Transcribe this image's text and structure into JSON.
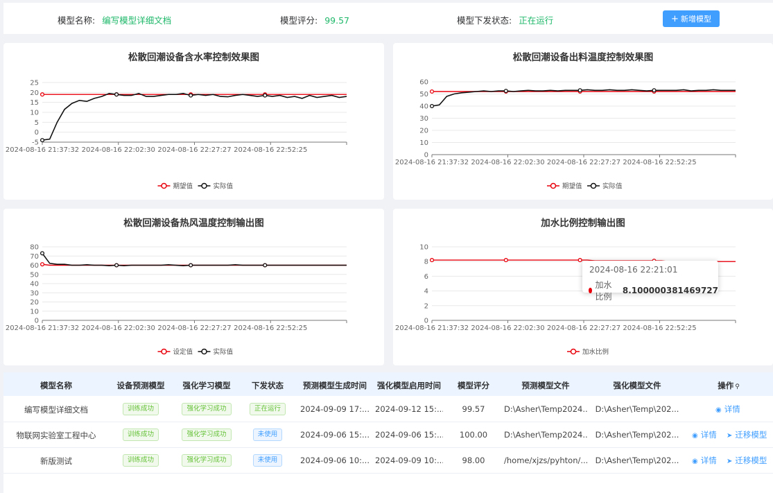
{
  "header": {
    "model_name_label": "模型名称:",
    "model_name_value": "编写模型详细文档",
    "score_label": "模型评分:",
    "score_value": "99.57",
    "status_label": "模型下发状态:",
    "status_value": "正在运行",
    "add_button": "新增模型"
  },
  "colors": {
    "accent": "#409eff",
    "success": "#1fb86a",
    "expected": "#e8000b",
    "actual": "#111111"
  },
  "chart_data": [
    {
      "type": "line",
      "title": "松散回潮设备含水率控制效果图",
      "x_ticks": [
        "2024-08-16 21:37:32",
        "2024-08-16 22:02:30",
        "2024-08-16 22:27:27",
        "2024-08-16 22:52:25"
      ],
      "ylim": [
        -5,
        25
      ],
      "y_ticks": [
        -5,
        0,
        5,
        10,
        15,
        20,
        25
      ],
      "legend": [
        "期望值",
        "实际值"
      ],
      "series": [
        {
          "name": "期望值",
          "values": [
            19,
            19,
            19,
            19,
            19,
            19,
            19,
            19,
            19,
            19,
            19,
            19,
            19,
            19,
            19,
            19,
            19,
            19,
            19,
            19,
            19,
            19,
            19,
            19,
            19,
            19,
            19,
            19,
            19,
            19,
            19,
            19,
            19,
            19,
            19,
            19,
            19,
            19,
            19,
            19,
            19,
            19
          ]
        },
        {
          "name": "实际值",
          "values": [
            -4,
            -3.5,
            5,
            11.5,
            14.5,
            16,
            15.5,
            17,
            18,
            19.5,
            19,
            18.5,
            18.5,
            19.5,
            18,
            18,
            18.5,
            19,
            19,
            19.5,
            18.5,
            19,
            18.5,
            19,
            18,
            17.8,
            18.5,
            19,
            18.5,
            18,
            18.5,
            18,
            18.5,
            17.5,
            18,
            17,
            18.5,
            17.5,
            18,
            18.5,
            17.5,
            18
          ]
        }
      ]
    },
    {
      "type": "line",
      "title": "松散回潮设备出料温度控制效果图",
      "x_ticks": [
        "2024-08-16 21:37:32",
        "2024-08-16 22:02:30",
        "2024-08-16 22:27:27",
        "2024-08-16 22:52:25"
      ],
      "ylim": [
        0,
        60
      ],
      "y_ticks": [
        0,
        10,
        20,
        30,
        40,
        50,
        60
      ],
      "legend": [
        "期望值",
        "实际值"
      ],
      "series": [
        {
          "name": "期望值",
          "values": [
            52,
            52,
            52,
            52,
            52,
            52,
            52,
            52,
            52,
            52,
            52,
            52,
            52,
            52,
            52,
            52,
            52,
            52,
            52,
            52,
            52,
            52,
            52,
            52,
            52,
            52,
            52,
            52,
            52,
            52,
            52,
            52,
            52,
            52,
            52,
            52,
            52,
            52,
            52,
            52,
            52,
            52
          ]
        },
        {
          "name": "实际值",
          "values": [
            40,
            41,
            48,
            50,
            51,
            51.5,
            52,
            52.5,
            52,
            52.5,
            52.5,
            52,
            52.5,
            53,
            52.5,
            52.5,
            53,
            52.5,
            53,
            53,
            53,
            53.5,
            53,
            53,
            53.5,
            53,
            53,
            53.5,
            53,
            52.5,
            53,
            53,
            53,
            53,
            53.5,
            52.5,
            53,
            53,
            53.5,
            53,
            53,
            53
          ]
        }
      ]
    },
    {
      "type": "line",
      "title": "松散回潮设备热风温度控制输出图",
      "x_ticks": [
        "2024-08-16 21:37:32",
        "2024-08-16 22:02:30",
        "2024-08-16 22:27:27",
        "2024-08-16 22:52:25"
      ],
      "ylim": [
        0,
        80
      ],
      "y_ticks": [
        0,
        10,
        20,
        30,
        40,
        50,
        60,
        70,
        80
      ],
      "legend": [
        "设定值",
        "实际值"
      ],
      "series": [
        {
          "name": "设定值",
          "values": [
            61,
            60,
            60,
            60,
            60,
            60,
            60,
            60,
            60,
            60,
            60,
            60,
            60,
            60,
            60,
            60,
            60,
            60,
            60,
            60,
            60,
            60,
            60,
            60,
            60,
            60,
            60,
            60,
            60,
            60,
            60,
            60,
            60,
            60,
            60,
            60,
            60,
            60,
            60,
            60,
            60,
            60
          ]
        },
        {
          "name": "实际值",
          "values": [
            73,
            62,
            61,
            61,
            60,
            60,
            60.5,
            60,
            60,
            59.5,
            60,
            59.5,
            60,
            60,
            60,
            60,
            60,
            60.5,
            60,
            59.5,
            60,
            60,
            60,
            60,
            60,
            60,
            60.5,
            60,
            60,
            60,
            60,
            60,
            60,
            60,
            60,
            60,
            60,
            60,
            60,
            60,
            60,
            60
          ]
        }
      ]
    },
    {
      "type": "line",
      "title": "加水比例控制输出图",
      "x_ticks": [
        "2024-08-16 21:37:32",
        "2024-08-16 22:02:30",
        "2024-08-16 22:27:27",
        "2024-08-16 22:52:25"
      ],
      "ylim": [
        0,
        10
      ],
      "y_ticks": [
        0,
        2,
        4,
        6,
        8,
        10
      ],
      "legend": [
        "加水比例"
      ],
      "series": [
        {
          "name": "加水比例",
          "values": [
            8.2,
            8.2,
            8.2,
            8.2,
            8.2,
            8.2,
            8.2,
            8.2,
            8.2,
            8.2,
            8.2,
            8.2,
            8.2,
            8.2,
            8.2,
            8.2,
            8.2,
            8.2,
            8.2,
            8.2,
            8.2,
            8.2,
            8.1,
            8.1,
            8.1,
            8.1,
            8.1,
            8.1,
            8.1,
            8.1,
            8.1,
            8.1,
            8.0,
            8.0,
            8.0,
            8.0,
            8.0,
            8.0,
            8.0,
            8.0,
            8.0,
            8.0
          ]
        }
      ],
      "tooltip": {
        "time": "2024-08-16 22:21:01",
        "series": "加水比例",
        "value": "8.100000381469727"
      }
    }
  ],
  "table": {
    "columns": [
      "模型名称",
      "设备预测模型",
      "强化学习模型",
      "下发状态",
      "预测模型生成时间",
      "强化模型启用时间",
      "模型评分",
      "预测模型文件",
      "强化模型文件",
      "操作"
    ],
    "rows": [
      {
        "name": "编写模型详细文档",
        "predict_tag": "训练成功",
        "rl_tag": "强化学习成功",
        "status": "正在运行",
        "status_type": "success",
        "gen_time": "2024-09-09 17:...",
        "enable_time": "2024-09-12 15:...",
        "score": "99.57",
        "predict_file": "D:\\Asher\\Temp2024...",
        "rl_file": "D:\\Asher\\Temp\\202...",
        "ops": [
          "详情"
        ]
      },
      {
        "name": "物联网实验室工程中心",
        "predict_tag": "训练成功",
        "rl_tag": "强化学习成功",
        "status": "未使用",
        "status_type": "info",
        "gen_time": "2024-09-06 15:...",
        "enable_time": "2024-09-06 15:...",
        "score": "100.00",
        "predict_file": "D:\\Asher\\Temp2024...",
        "rl_file": "D:\\Asher\\Temp\\202...",
        "ops": [
          "详情",
          "迁移模型"
        ]
      },
      {
        "name": "新版测试",
        "predict_tag": "训练成功",
        "rl_tag": "强化学习成功",
        "status": "未使用",
        "status_type": "info",
        "gen_time": "2024-09-06 10:...",
        "enable_time": "2024-09-09 10:...",
        "score": "98.00",
        "predict_file": "/home/xjzs/pyhton/...",
        "rl_file": "D:\\Asher\\Temp\\202...",
        "ops": [
          "详情",
          "迁移模型"
        ]
      }
    ]
  }
}
